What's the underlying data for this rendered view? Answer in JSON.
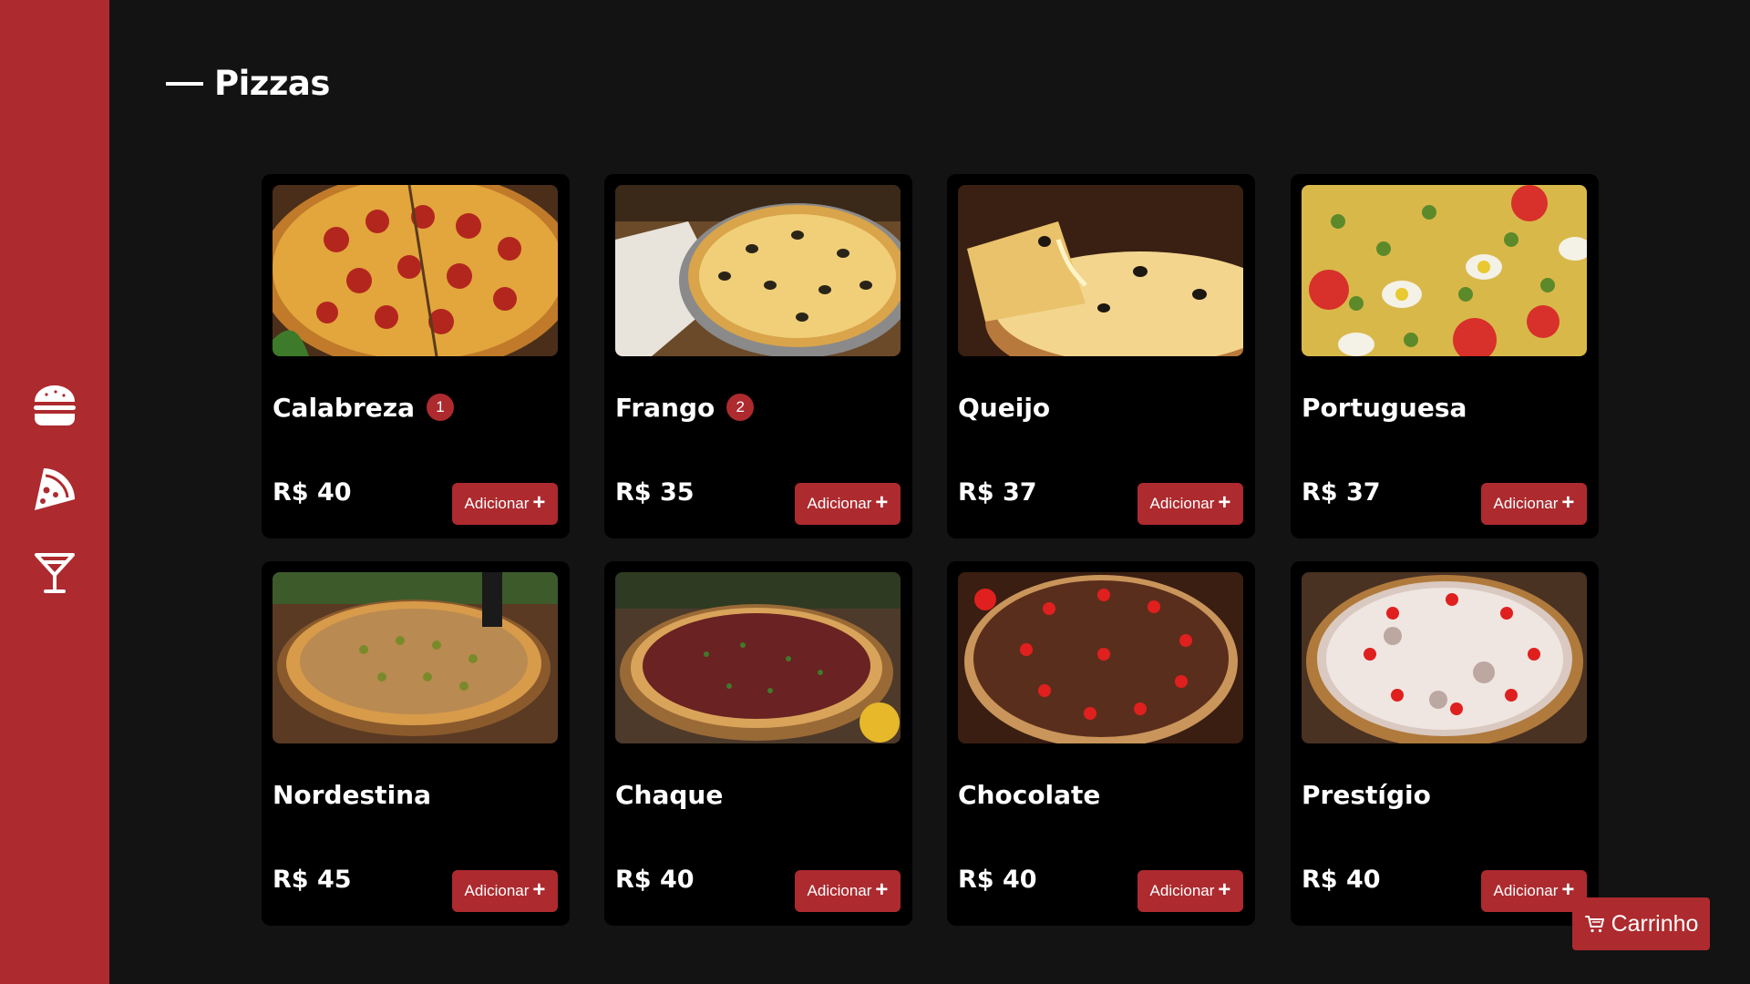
{
  "sidebar": {
    "items": [
      {
        "icon": "burger-icon"
      },
      {
        "icon": "pizza-icon"
      },
      {
        "icon": "cocktail-icon"
      }
    ]
  },
  "page": {
    "title": "Pizzas"
  },
  "colors": {
    "accent": "#ad2a2e",
    "background": "#131313",
    "card": "#000000",
    "text": "#ffffff"
  },
  "products": [
    {
      "name": "Calabreza",
      "badge": "1",
      "price": "R$ 40",
      "button": "Adicionar"
    },
    {
      "name": "Frango",
      "badge": "2",
      "price": "R$ 35",
      "button": "Adicionar"
    },
    {
      "name": "Queijo",
      "price": "R$ 37",
      "button": "Adicionar"
    },
    {
      "name": "Portuguesa",
      "price": "R$ 37",
      "button": "Adicionar"
    },
    {
      "name": "Nordestina",
      "price": "R$ 45",
      "button": "Adicionar"
    },
    {
      "name": "Chaque",
      "price": "R$ 40",
      "button": "Adicionar"
    },
    {
      "name": "Chocolate",
      "price": "R$ 40",
      "button": "Adicionar"
    },
    {
      "name": "Prestígio",
      "price": "R$ 40",
      "button": "Adicionar"
    }
  ],
  "cart": {
    "label": "Carrinho",
    "icon": "cart-icon"
  }
}
